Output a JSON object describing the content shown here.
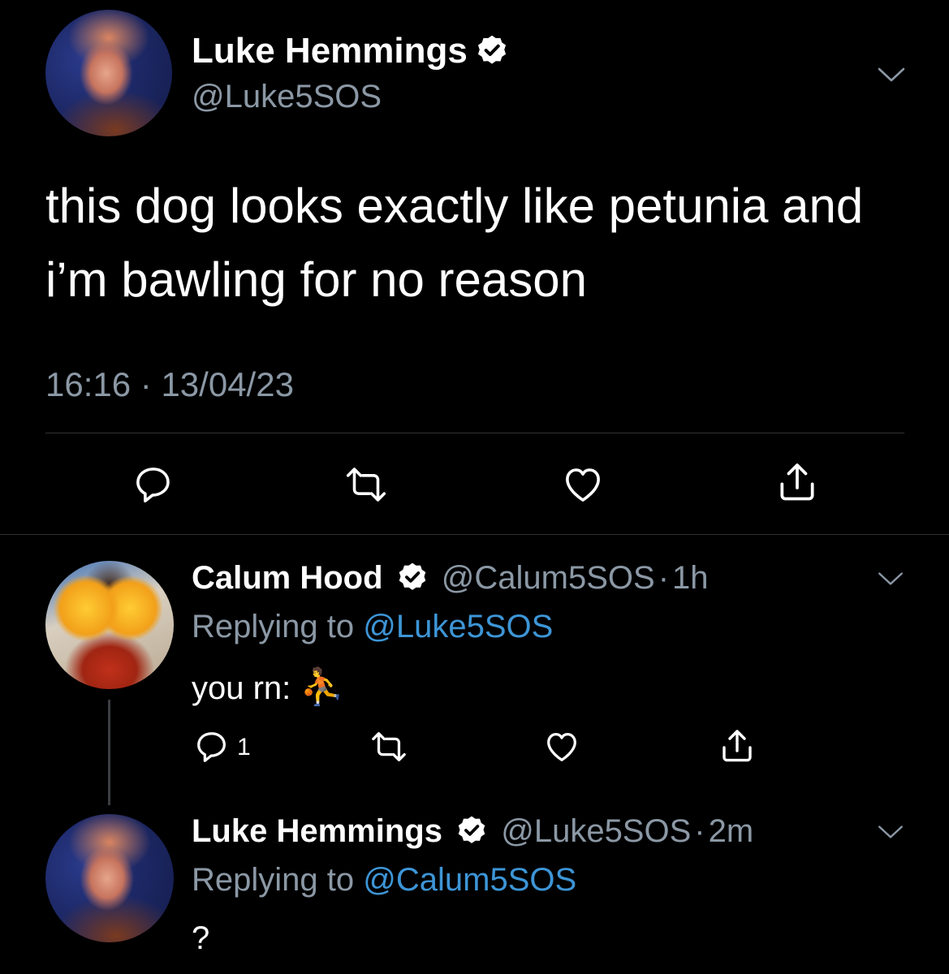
{
  "main_tweet": {
    "author_name": "Luke Hemmings",
    "author_handle": "@Luke5SOS",
    "text_line1": "this dog looks exactly like petunia and",
    "text_line2": "i’m bawling for no reason",
    "time": "16:16",
    "separator": "·",
    "date": "13/04/23"
  },
  "replies": [
    {
      "author_name": "Calum Hood",
      "author_handle": "@Calum5SOS",
      "separator": "·",
      "age": "1h",
      "replying_label": "Replying to",
      "replying_to": "@Luke5SOS",
      "text": "you rn:",
      "emoji": "⛹",
      "reply_count": "1"
    },
    {
      "author_name": "Luke Hemmings",
      "author_handle": "@Luke5SOS",
      "separator": "·",
      "age": "2m",
      "replying_label": "Replying to",
      "replying_to": "@Calum5SOS",
      "text": "?"
    }
  ],
  "colors": {
    "background": "#000000",
    "secondary_text": "#8b98a5",
    "link": "#3d95d6",
    "icon": "#ffffff"
  },
  "icons": [
    "verified-badge-icon",
    "chevron-down-icon",
    "reply-icon",
    "retweet-icon",
    "like-icon",
    "share-icon"
  ]
}
